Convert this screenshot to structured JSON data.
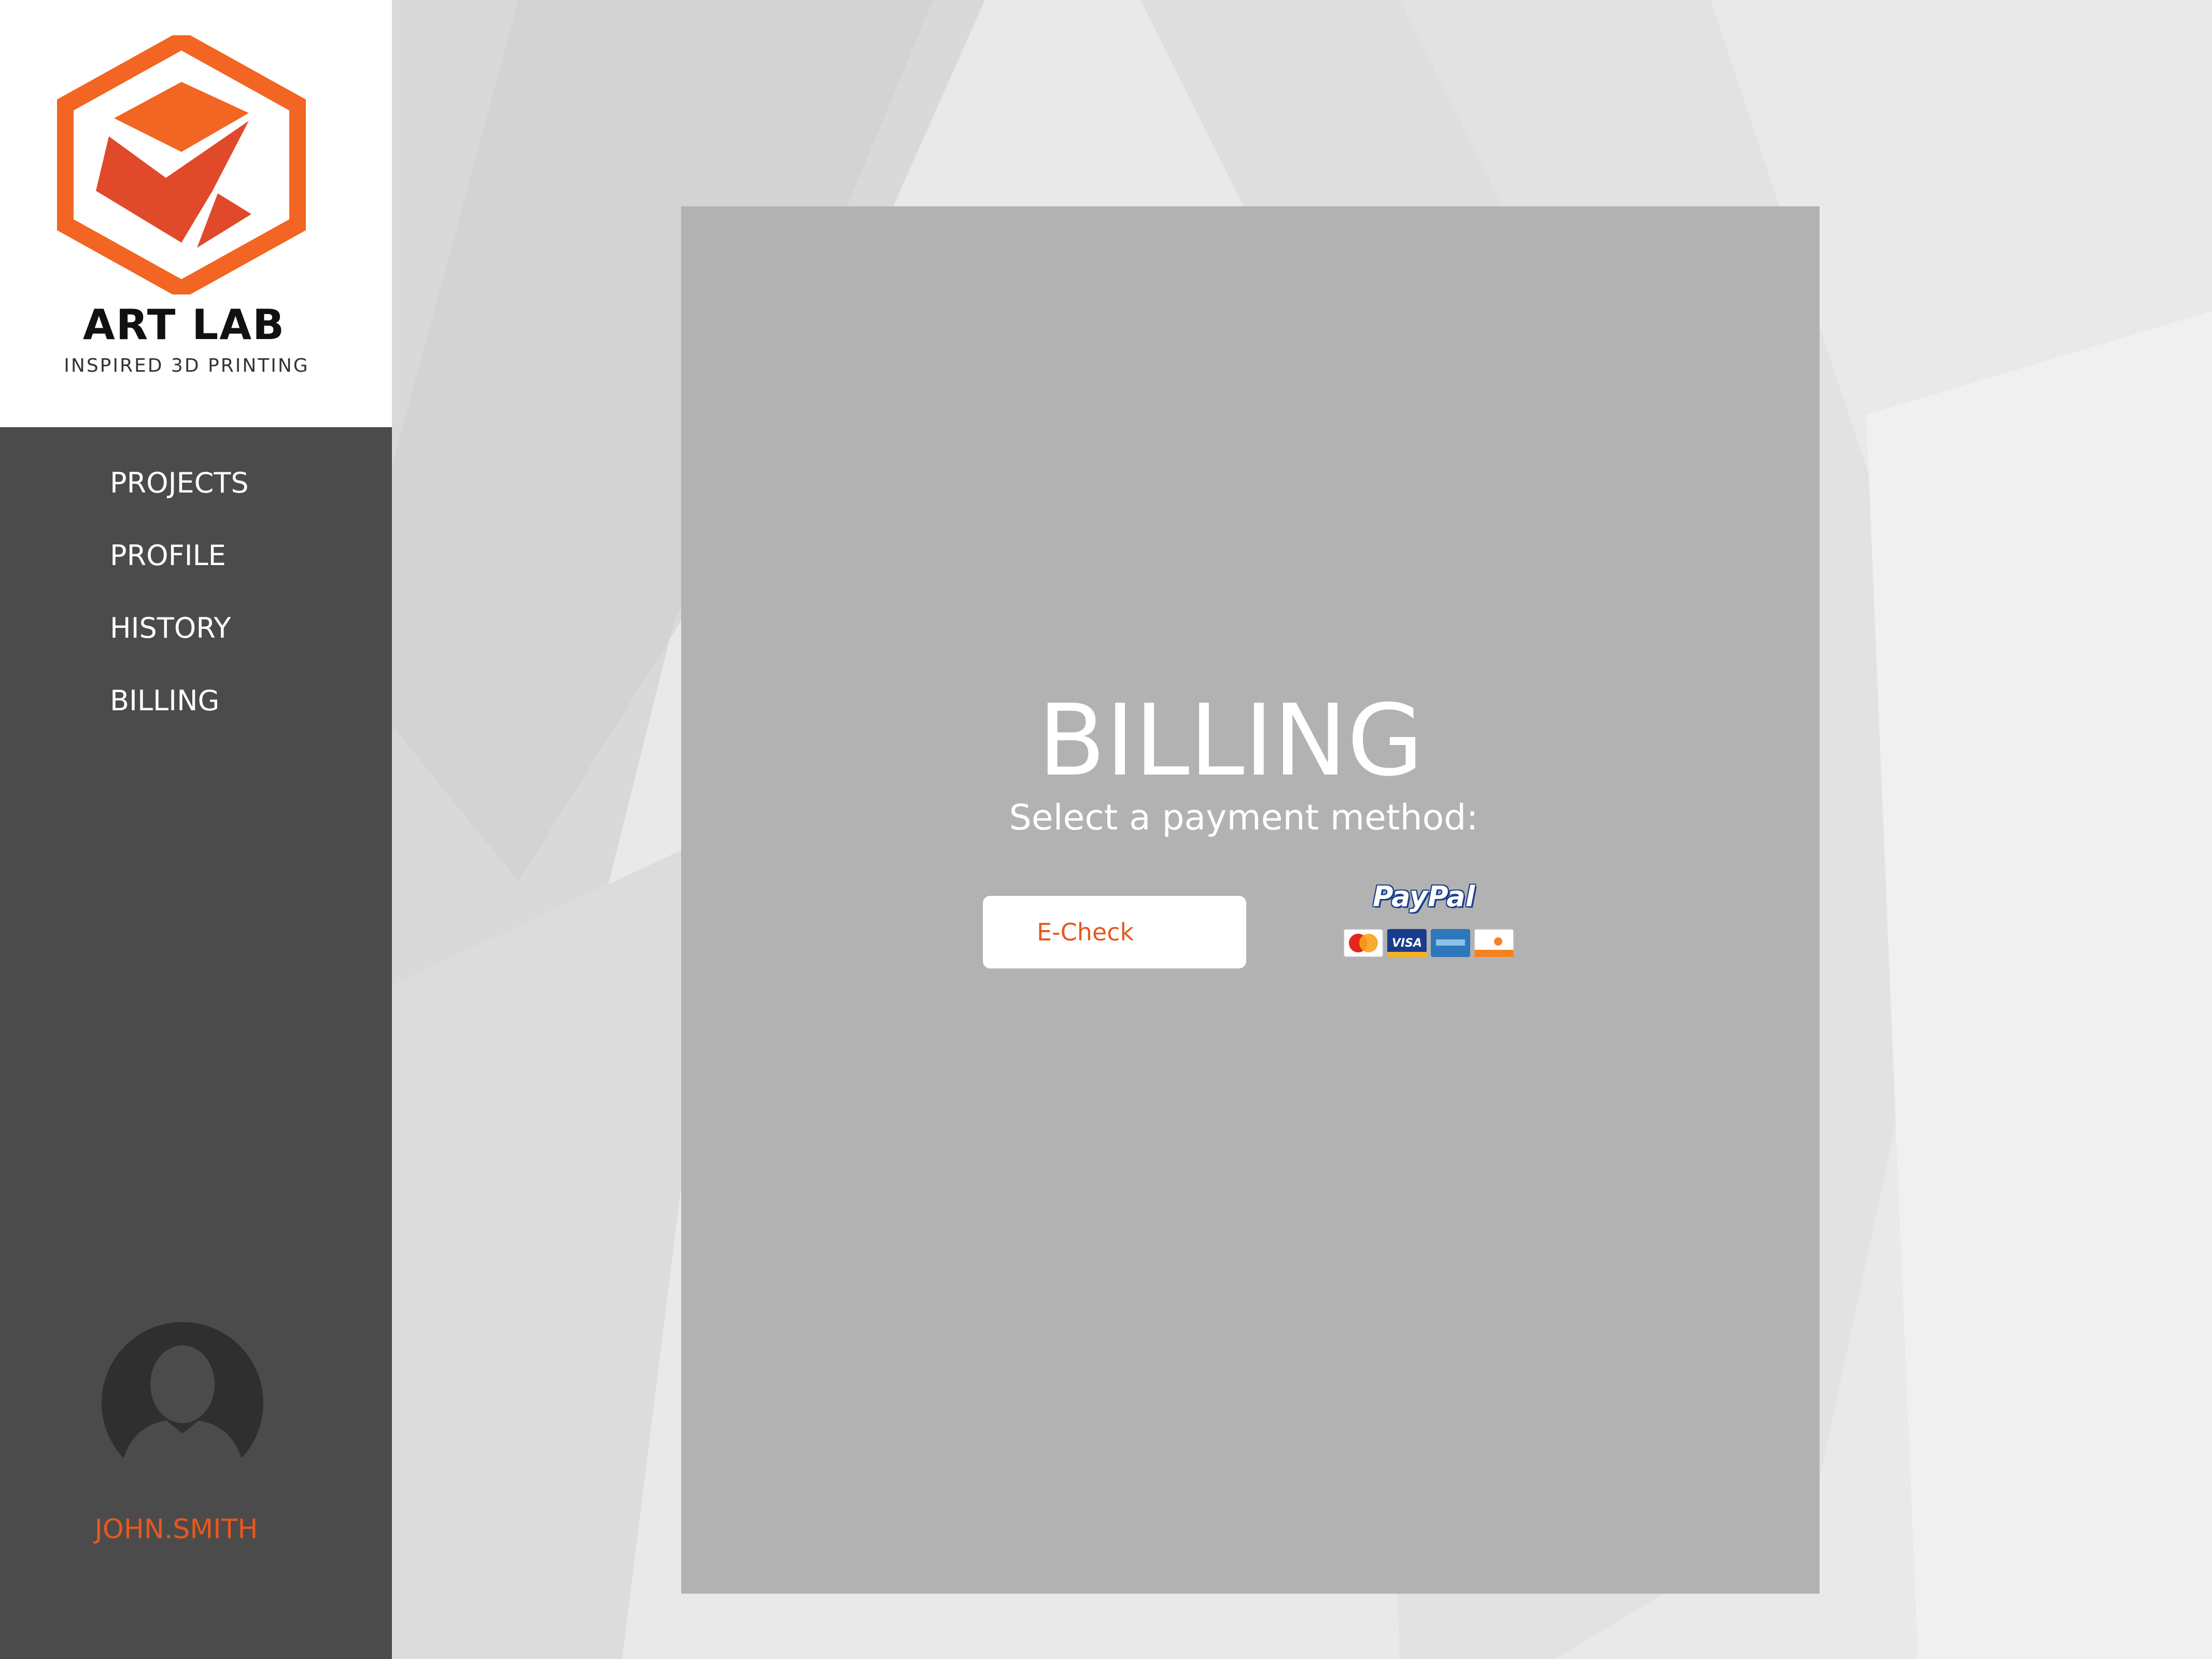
{
  "brand": {
    "name": "ART LAB",
    "tagline": "INSPIRED 3D PRINTING",
    "colors": {
      "orange": "#f26522",
      "red_orange": "#e04a2a"
    }
  },
  "nav": {
    "items": [
      {
        "label": "PROJECTS"
      },
      {
        "label": "PROFILE"
      },
      {
        "label": "HISTORY"
      },
      {
        "label": "BILLING"
      }
    ]
  },
  "user": {
    "name": "JOHN.SMITH",
    "avatar_icon": "user-silhouette-icon"
  },
  "main": {
    "title": "BILLING",
    "subtitle": "Select a payment method:",
    "echeck_label": "E-Check",
    "paypal": {
      "logo_text": "PayPal",
      "cards": [
        "MasterCard",
        "VISA",
        "AMERICAN EXPRESS",
        "DISCOVER"
      ]
    }
  },
  "colors": {
    "sidebar": "#4b4b4b",
    "panel": "#b2b2b2",
    "accent": "#e8581c",
    "background": "#e9e9e9"
  }
}
